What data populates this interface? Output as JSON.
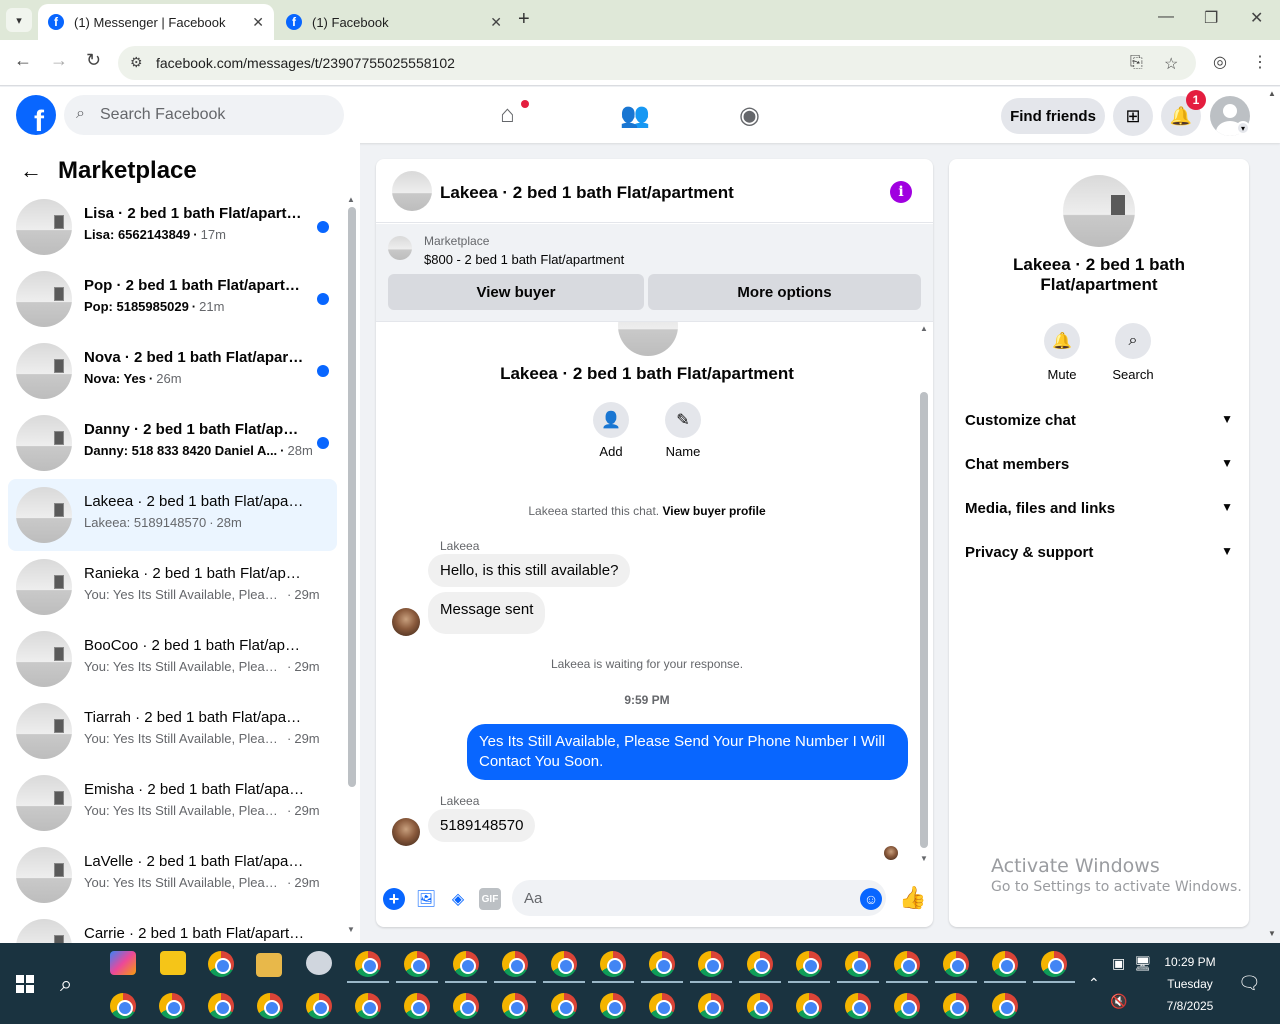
{
  "browser": {
    "tabs": [
      {
        "title": "(1) Messenger | Facebook",
        "active": true
      },
      {
        "title": "(1) Facebook",
        "active": false
      }
    ],
    "url": "facebook.com/messages/t/23907755025558102"
  },
  "header": {
    "search_placeholder": "Search Facebook",
    "find_friends": "Find friends",
    "notification_count": "1"
  },
  "sidebar": {
    "title": "Marketplace",
    "conversations": [
      {
        "name": "Lisa · 2 bed 1 bath Flat/apartment",
        "preview": "Lisa: 6562143849",
        "time": "17m",
        "unread": true
      },
      {
        "name": "Pop · 2 bed 1 bath Flat/apartment",
        "preview": "Pop: 5185985029",
        "time": "21m",
        "unread": true
      },
      {
        "name": "Nova · 2 bed 1 bath Flat/apartment",
        "preview": "Nova: Yes",
        "time": "26m",
        "unread": true
      },
      {
        "name": "Danny · 2 bed 1 bath Flat/apartment",
        "preview": "Danny: 518 833 8420 Daniel A...",
        "time": "28m",
        "unread": true
      },
      {
        "name": "Lakeea · 2 bed 1 bath Flat/apartment",
        "preview": "Lakeea: 5189148570",
        "time": "28m",
        "unread": false,
        "active": true
      },
      {
        "name": "Ranieka · 2 bed 1 bath Flat/apartment",
        "preview": "You: Yes Its Still Available, Please ...",
        "time": "29m",
        "unread": false
      },
      {
        "name": "BooCoo · 2 bed 1 bath Flat/apartment",
        "preview": "You: Yes Its Still Available, Please ...",
        "time": "29m",
        "unread": false
      },
      {
        "name": "Tiarrah · 2 bed 1 bath Flat/apartment",
        "preview": "You: Yes Its Still Available, Please ...",
        "time": "29m",
        "unread": false
      },
      {
        "name": "Emisha · 2 bed 1 bath Flat/apartment",
        "preview": "You: Yes Its Still Available, Please ...",
        "time": "29m",
        "unread": false
      },
      {
        "name": "LaVelle · 2 bed 1 bath Flat/apartment",
        "preview": "You: Yes Its Still Available, Please ...",
        "time": "29m",
        "unread": false
      },
      {
        "name": "Carrie · 2 bed 1 bath Flat/apartment",
        "preview": "",
        "time": "",
        "unread": false
      }
    ]
  },
  "chat": {
    "title": "Lakeea · 2 bed 1 bath Flat/apartment",
    "listing_label": "Marketplace",
    "listing_title": "$800 - 2 bed 1 bath Flat/apartment",
    "view_buyer": "View buyer",
    "more_options": "More options",
    "intro_title": "Lakeea · 2 bed 1 bath Flat/apartment",
    "add_label": "Add",
    "name_label": "Name",
    "started_text": "Lakeea started this chat.",
    "view_buyer_profile": "View buyer profile",
    "sender": "Lakeea",
    "msg1": "Hello, is this still available?",
    "msg2": "Message sent",
    "waiting": "Lakeea is waiting for your response.",
    "timestamp": "9:59 PM",
    "outgoing": "Yes Its Still Available, Please Send Your Phone Number I Will Contact You Soon.",
    "sender2": "Lakeea",
    "msg3": "5189148570",
    "input_placeholder": "Aa"
  },
  "details": {
    "name": "Lakeea · 2 bed 1 bath Flat/apartment",
    "mute": "Mute",
    "search": "Search",
    "sections": [
      "Customize chat",
      "Chat members",
      "Media, files and links",
      "Privacy & support"
    ]
  },
  "watermark": {
    "line1": "Activate Windows",
    "line2": "Go to Settings to activate Windows."
  },
  "taskbar": {
    "time": "10:29 PM",
    "day": "Tuesday",
    "date": "7/8/2025"
  }
}
